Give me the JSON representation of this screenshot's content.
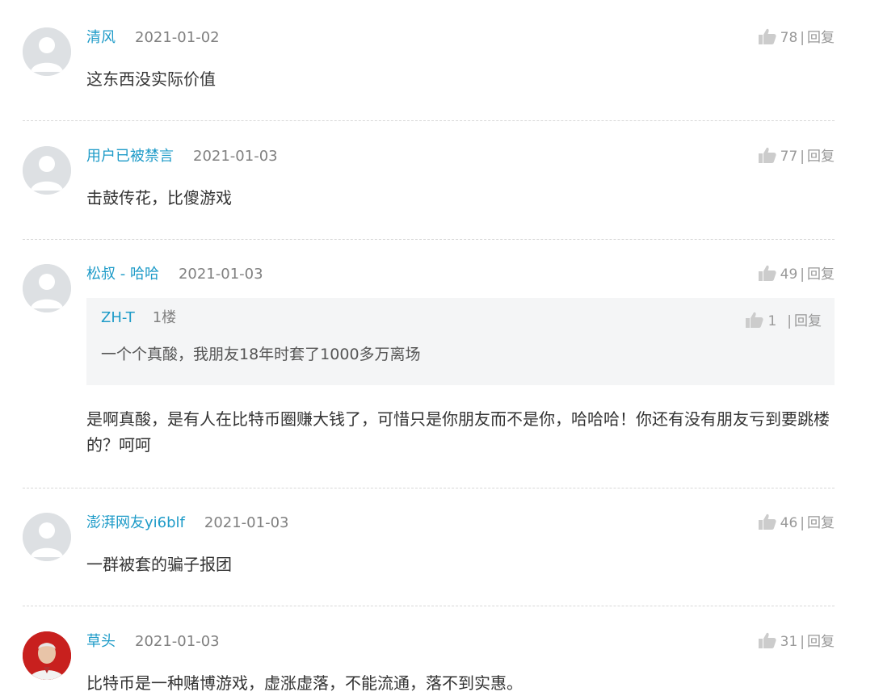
{
  "colors": {
    "username": "#1e9bc8",
    "date": "#808080",
    "meta": "#999999",
    "text": "#333333",
    "quote_bg": "#f4f5f6",
    "avatar_bg": "#dde0e3"
  },
  "comments": [
    {
      "username": "清风",
      "date": "2021-01-02",
      "likes": "78",
      "reply_label": "回复",
      "text": "这东西没实际价值",
      "avatar_icon": "default-avatar-icon"
    },
    {
      "username": "用户已被禁言",
      "date": "2021-01-03",
      "likes": "77",
      "reply_label": "回复",
      "text": "击鼓传花，比傻游戏",
      "avatar_icon": "default-avatar-icon"
    },
    {
      "username": "松叔 - 哈哈",
      "date": "2021-01-03",
      "likes": "49",
      "reply_label": "回复",
      "text": "是啊真酸，是有人在比特币圈赚大钱了，可惜只是你朋友而不是你，哈哈哈！你还有没有朋友亏到要跳楼的？呵呵",
      "avatar_icon": "default-avatar-icon",
      "quote": {
        "username": "ZH-T",
        "floor": "1楼",
        "likes": "1",
        "reply_label": "回复",
        "text": "一个个真酸，我朋友18年时套了1000多万离场"
      }
    },
    {
      "username": "澎湃网友yi6blf",
      "date": "2021-01-03",
      "likes": "46",
      "reply_label": "回复",
      "text": "一群被套的骗子报团",
      "avatar_icon": "default-avatar-icon"
    },
    {
      "username": "草头",
      "date": "2021-01-03",
      "likes": "31",
      "reply_label": "回复",
      "text": "比特币是一种赌博游戏，虚涨虚落，不能流通，落不到实惠。",
      "avatar_icon": "user-photo-avatar"
    }
  ]
}
